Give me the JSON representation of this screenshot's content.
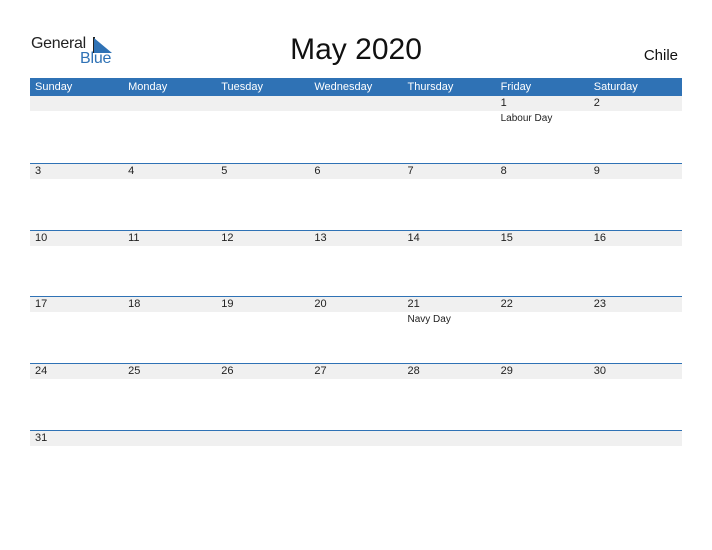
{
  "logo": {
    "text_general": "General",
    "text_blue": "Blue"
  },
  "title": "May 2020",
  "country": "Chile",
  "colors": {
    "accent": "#2f72b5",
    "band": "#f0f0f0"
  },
  "weekdays": [
    "Sunday",
    "Monday",
    "Tuesday",
    "Wednesday",
    "Thursday",
    "Friday",
    "Saturday"
  ],
  "weeks": [
    [
      {
        "day": ""
      },
      {
        "day": ""
      },
      {
        "day": ""
      },
      {
        "day": ""
      },
      {
        "day": ""
      },
      {
        "day": "1",
        "event": "Labour Day"
      },
      {
        "day": "2"
      }
    ],
    [
      {
        "day": "3"
      },
      {
        "day": "4"
      },
      {
        "day": "5"
      },
      {
        "day": "6"
      },
      {
        "day": "7"
      },
      {
        "day": "8"
      },
      {
        "day": "9"
      }
    ],
    [
      {
        "day": "10"
      },
      {
        "day": "11"
      },
      {
        "day": "12"
      },
      {
        "day": "13"
      },
      {
        "day": "14"
      },
      {
        "day": "15"
      },
      {
        "day": "16"
      }
    ],
    [
      {
        "day": "17"
      },
      {
        "day": "18"
      },
      {
        "day": "19"
      },
      {
        "day": "20"
      },
      {
        "day": "21",
        "event": "Navy Day"
      },
      {
        "day": "22"
      },
      {
        "day": "23"
      }
    ],
    [
      {
        "day": "24"
      },
      {
        "day": "25"
      },
      {
        "day": "26"
      },
      {
        "day": "27"
      },
      {
        "day": "28"
      },
      {
        "day": "29"
      },
      {
        "day": "30"
      }
    ],
    [
      {
        "day": "31"
      },
      {
        "day": ""
      },
      {
        "day": ""
      },
      {
        "day": ""
      },
      {
        "day": ""
      },
      {
        "day": ""
      },
      {
        "day": ""
      }
    ]
  ]
}
